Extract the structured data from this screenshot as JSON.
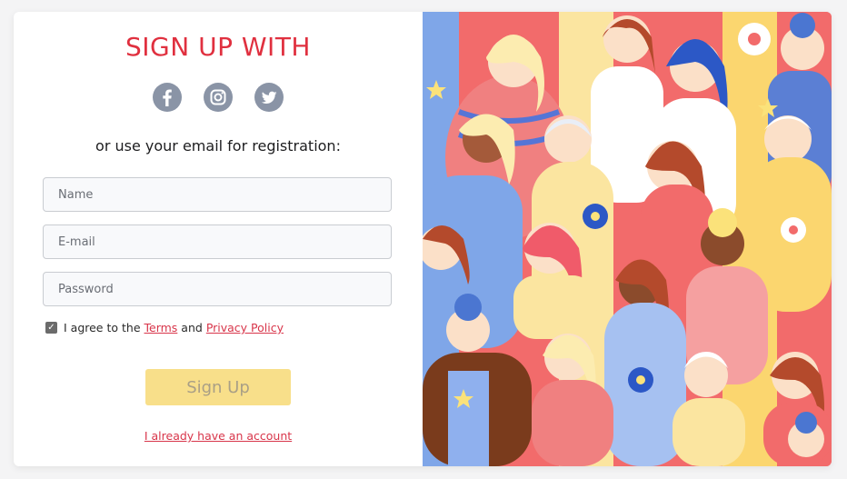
{
  "form": {
    "title": "SIGN UP WITH",
    "subtitle": "or use your email for registration:",
    "name_placeholder": "Name",
    "email_placeholder": "E-mail",
    "password_placeholder": "Password",
    "agree_text": "I agree to the",
    "terms_link": "Terms",
    "and_text": "and",
    "privacy_link": "Privacy Policy",
    "signup_label": "Sign Up",
    "account_link": "I already have an account",
    "checkbox_checked": true
  },
  "socials": [
    "facebook-icon",
    "instagram-icon",
    "twitter-icon"
  ],
  "colors": {
    "accent": "#e0303f",
    "button": "#f8df8a",
    "link": "#d8354a",
    "icon": "#8a94a6"
  }
}
